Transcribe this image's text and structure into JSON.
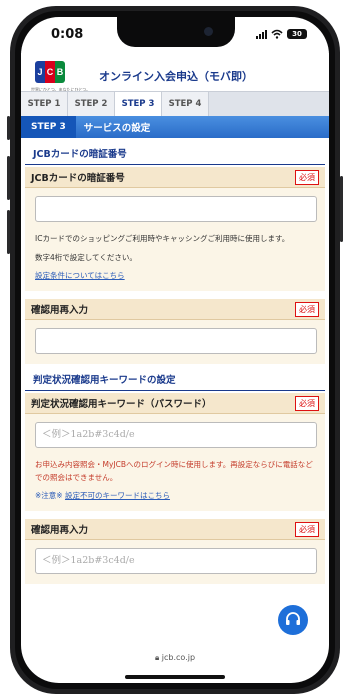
{
  "status": {
    "time": "0:08",
    "battery": "30"
  },
  "header": {
    "logo_letters": [
      "J",
      "C",
      "B"
    ],
    "logo_colors": [
      "#1b3f9e",
      "#d7001b",
      "#0a8a3c"
    ],
    "logo_tagline": "世界にひとつ。あなたにひとつ。",
    "title": "オンライン入会申込（モバ即）"
  },
  "steps": [
    "STEP 1",
    "STEP 2",
    "STEP 3",
    "STEP 4"
  ],
  "step_bar": {
    "label": "STEP 3",
    "text": "サービスの設定"
  },
  "section1": {
    "title": "JCBカードの暗証番号"
  },
  "pin_field": {
    "label": "JCBカードの暗証番号",
    "required": "必須",
    "note1": "ICカードでのショッピングご利用時やキャッシングご利用時に使用します。",
    "note2": "数字4桁で設定してください。",
    "link": "設定条件についてはこちら"
  },
  "pin_confirm": {
    "label": "確認用再入力",
    "required": "必須"
  },
  "section2": {
    "title": "判定状況確認用キーワードの設定"
  },
  "keyword_field": {
    "label": "判定状況確認用キーワード（パスワード）",
    "required": "必須",
    "placeholder": "＜例＞1a2b#3c4d/e",
    "note": "お申込み内容照会・MyJCBへのログイン時に使用します。再設定ならびに電話などでの照会はできません。",
    "warning_prefix": "※注意※",
    "warning_link": "設定不可のキーワードはこちら"
  },
  "keyword_confirm": {
    "label": "確認用再入力",
    "required": "必須",
    "placeholder": "＜例＞1a2b#3c4d/e"
  },
  "url": "jcb.co.jp"
}
